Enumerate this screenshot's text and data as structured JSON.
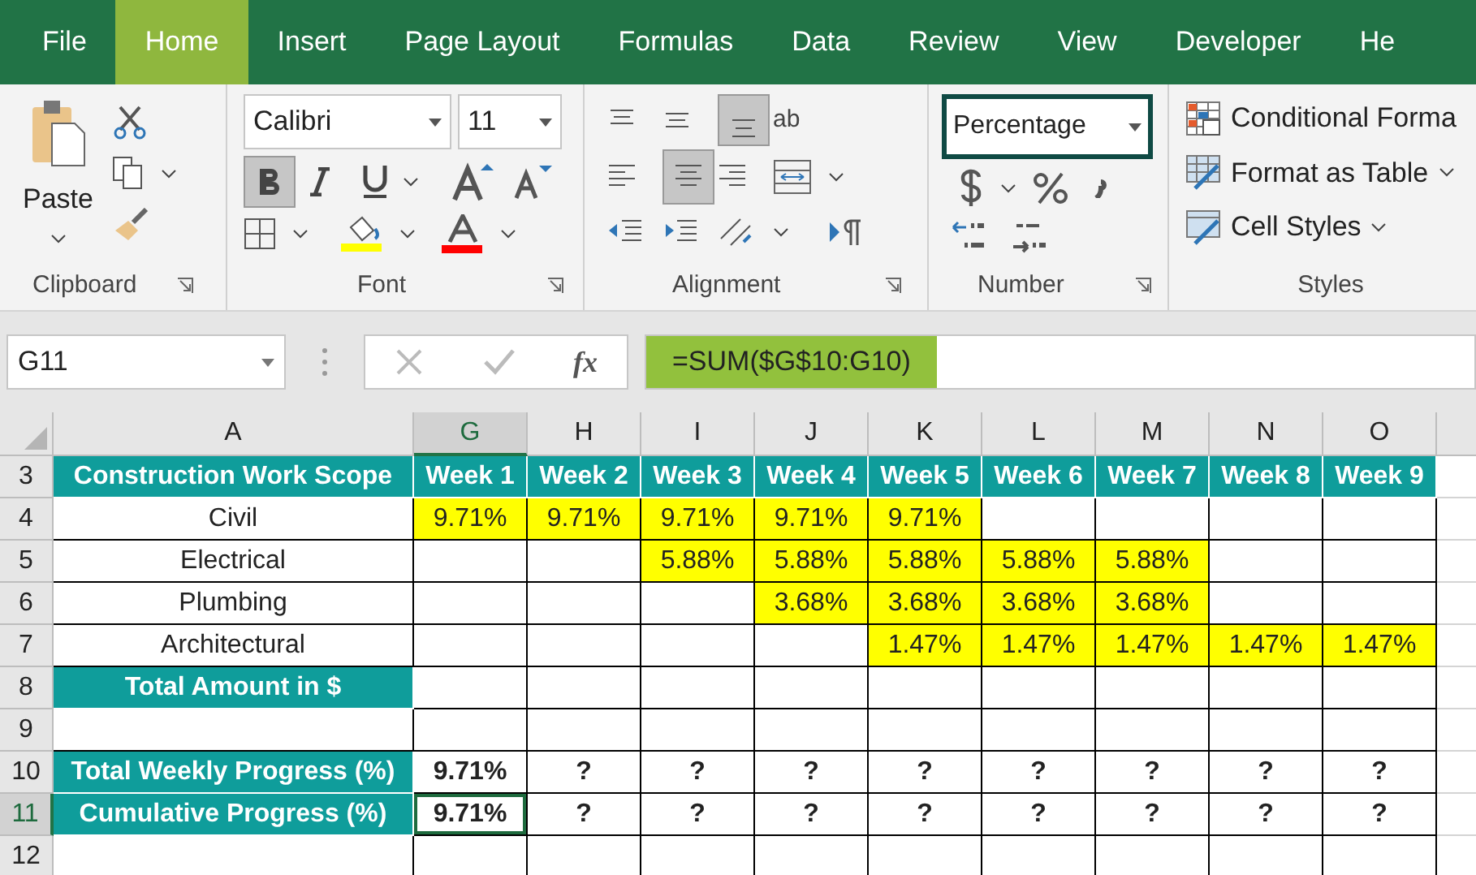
{
  "tabs": [
    {
      "label": "File",
      "selected": false
    },
    {
      "label": "Home",
      "selected": true
    },
    {
      "label": "Insert",
      "selected": false
    },
    {
      "label": "Page Layout",
      "selected": false
    },
    {
      "label": "Formulas",
      "selected": false
    },
    {
      "label": "Data",
      "selected": false
    },
    {
      "label": "Review",
      "selected": false
    },
    {
      "label": "View",
      "selected": false
    },
    {
      "label": "Developer",
      "selected": false
    },
    {
      "label": "He",
      "selected": false
    }
  ],
  "ribbon": {
    "clipboard": {
      "paste": "Paste",
      "label": "Clipboard"
    },
    "font": {
      "name": "Calibri",
      "size": "11",
      "bold_on": true,
      "label": "Font"
    },
    "alignment": {
      "wrap_text": "ab",
      "label": "Alignment"
    },
    "number": {
      "format": "Percentage",
      "label": "Number"
    },
    "styles": {
      "items": [
        "Conditional Forma",
        "Format as Table",
        "Cell Styles"
      ],
      "label": "Styles"
    }
  },
  "formula_bar": {
    "name_box": "G11",
    "function": "fx",
    "formula": "=SUM($G$10:G10)"
  },
  "sheet": {
    "columns": [
      {
        "label": "A",
        "selected": false
      },
      {
        "label": "G",
        "selected": true
      },
      {
        "label": "H",
        "selected": false
      },
      {
        "label": "I",
        "selected": false
      },
      {
        "label": "J",
        "selected": false
      },
      {
        "label": "K",
        "selected": false
      },
      {
        "label": "L",
        "selected": false
      },
      {
        "label": "M",
        "selected": false
      },
      {
        "label": "N",
        "selected": false
      },
      {
        "label": "O",
        "selected": false
      }
    ],
    "rows": [
      {
        "number": "3",
        "selected": false,
        "cells": [
          {
            "text": "Construction Work Scope",
            "kind": "heading",
            "selected": false
          },
          {
            "text": "Week 1",
            "kind": "heading",
            "selected": false
          },
          {
            "text": "Week 2",
            "kind": "heading",
            "selected": false
          },
          {
            "text": "Week 3",
            "kind": "heading",
            "selected": false
          },
          {
            "text": "Week 4",
            "kind": "heading",
            "selected": false
          },
          {
            "text": "Week 5",
            "kind": "heading",
            "selected": false
          },
          {
            "text": "Week 6",
            "kind": "heading",
            "selected": false
          },
          {
            "text": "Week 7",
            "kind": "heading",
            "selected": false
          },
          {
            "text": "Week 8",
            "kind": "heading",
            "selected": false
          },
          {
            "text": "Week 9",
            "kind": "heading",
            "selected": false
          }
        ]
      },
      {
        "number": "4",
        "selected": false,
        "cells": [
          {
            "text": "Civil",
            "kind": "plain",
            "selected": false
          },
          {
            "text": "9.71%",
            "kind": "value",
            "selected": false
          },
          {
            "text": "9.71%",
            "kind": "value",
            "selected": false
          },
          {
            "text": "9.71%",
            "kind": "value",
            "selected": false
          },
          {
            "text": "9.71%",
            "kind": "value",
            "selected": false
          },
          {
            "text": "9.71%",
            "kind": "value",
            "selected": false
          },
          {
            "kind": "plain",
            "selected": false
          },
          {
            "kind": "plain",
            "selected": false
          },
          {
            "kind": "plain",
            "selected": false
          },
          {
            "kind": "plain",
            "selected": false
          }
        ]
      },
      {
        "number": "5",
        "selected": false,
        "cells": [
          {
            "text": "Electrical",
            "kind": "plain",
            "selected": false
          },
          {
            "kind": "plain",
            "selected": false
          },
          {
            "kind": "plain",
            "selected": false
          },
          {
            "text": "5.88%",
            "kind": "value",
            "selected": false
          },
          {
            "text": "5.88%",
            "kind": "value",
            "selected": false
          },
          {
            "text": "5.88%",
            "kind": "value",
            "selected": false
          },
          {
            "text": "5.88%",
            "kind": "value",
            "selected": false
          },
          {
            "text": "5.88%",
            "kind": "value",
            "selected": false
          },
          {
            "kind": "plain",
            "selected": false
          },
          {
            "kind": "plain",
            "selected": false
          }
        ]
      },
      {
        "number": "6",
        "selected": false,
        "cells": [
          {
            "text": "Plumbing",
            "kind": "plain",
            "selected": false
          },
          {
            "kind": "plain",
            "selected": false
          },
          {
            "kind": "plain",
            "selected": false
          },
          {
            "kind": "plain",
            "selected": false
          },
          {
            "text": "3.68%",
            "kind": "value",
            "selected": false
          },
          {
            "text": "3.68%",
            "kind": "value",
            "selected": false
          },
          {
            "text": "3.68%",
            "kind": "value",
            "selected": false
          },
          {
            "text": "3.68%",
            "kind": "value",
            "selected": false
          },
          {
            "kind": "plain",
            "selected": false
          },
          {
            "kind": "plain",
            "selected": false
          }
        ]
      },
      {
        "number": "7",
        "selected": false,
        "cells": [
          {
            "text": "Architectural",
            "kind": "plain",
            "selected": false
          },
          {
            "kind": "plain",
            "selected": false
          },
          {
            "kind": "plain",
            "selected": false
          },
          {
            "kind": "plain",
            "selected": false
          },
          {
            "kind": "plain",
            "selected": false
          },
          {
            "text": "1.47%",
            "kind": "value",
            "selected": false
          },
          {
            "text": "1.47%",
            "kind": "value",
            "selected": false
          },
          {
            "text": "1.47%",
            "kind": "value",
            "selected": false
          },
          {
            "text": "1.47%",
            "kind": "value",
            "selected": false
          },
          {
            "text": "1.47%",
            "kind": "value",
            "selected": false
          }
        ]
      },
      {
        "number": "8",
        "selected": false,
        "cells": [
          {
            "text": "Total Amount in $",
            "kind": "heading",
            "selected": false
          },
          {
            "kind": "plain",
            "selected": false
          },
          {
            "kind": "plain",
            "selected": false
          },
          {
            "kind": "plain",
            "selected": false
          },
          {
            "kind": "plain",
            "selected": false
          },
          {
            "kind": "plain",
            "selected": false
          },
          {
            "kind": "plain",
            "selected": false
          },
          {
            "kind": "plain",
            "selected": false
          },
          {
            "kind": "plain",
            "selected": false
          },
          {
            "kind": "plain",
            "selected": false
          }
        ]
      },
      {
        "number": "9",
        "selected": false,
        "cells": [
          {
            "kind": "plain",
            "selected": false
          },
          {
            "kind": "plain",
            "selected": false
          },
          {
            "kind": "plain",
            "selected": false
          },
          {
            "kind": "plain",
            "selected": false
          },
          {
            "kind": "plain",
            "selected": false
          },
          {
            "kind": "plain",
            "selected": false
          },
          {
            "kind": "plain",
            "selected": false
          },
          {
            "kind": "plain",
            "selected": false
          },
          {
            "kind": "plain",
            "selected": false
          },
          {
            "kind": "plain",
            "selected": false
          }
        ]
      },
      {
        "number": "10",
        "selected": false,
        "cells": [
          {
            "text": "Total Weekly Progress (%)",
            "kind": "heading",
            "selected": false
          },
          {
            "text": "9.71%",
            "kind": "result",
            "selected": false
          },
          {
            "text": "?",
            "kind": "result",
            "selected": false
          },
          {
            "text": "?",
            "kind": "result",
            "selected": false
          },
          {
            "text": "?",
            "kind": "result",
            "selected": false
          },
          {
            "text": "?",
            "kind": "result",
            "selected": false
          },
          {
            "text": "?",
            "kind": "result",
            "selected": false
          },
          {
            "text": "?",
            "kind": "result",
            "selected": false
          },
          {
            "text": "?",
            "kind": "result",
            "selected": false
          },
          {
            "text": "?",
            "kind": "result",
            "selected": false
          }
        ]
      },
      {
        "number": "11",
        "selected": true,
        "cells": [
          {
            "text": "Cumulative Progress (%)",
            "kind": "heading",
            "selected": false
          },
          {
            "text": "9.71%",
            "kind": "result",
            "selected": true
          },
          {
            "text": "?",
            "kind": "result",
            "selected": false
          },
          {
            "text": "?",
            "kind": "result",
            "selected": false
          },
          {
            "text": "?",
            "kind": "result",
            "selected": false
          },
          {
            "text": "?",
            "kind": "result",
            "selected": false
          },
          {
            "text": "?",
            "kind": "result",
            "selected": false
          },
          {
            "text": "?",
            "kind": "result",
            "selected": false
          },
          {
            "text": "?",
            "kind": "result",
            "selected": false
          },
          {
            "text": "?",
            "kind": "result",
            "selected": false
          }
        ]
      },
      {
        "number": "12",
        "selected": false,
        "cells": [
          {
            "kind": "plain",
            "selected": false
          },
          {
            "kind": "plain",
            "selected": false
          },
          {
            "kind": "plain",
            "selected": false
          },
          {
            "kind": "plain",
            "selected": false
          },
          {
            "kind": "plain",
            "selected": false
          },
          {
            "kind": "plain",
            "selected": false
          },
          {
            "kind": "plain",
            "selected": false
          },
          {
            "kind": "plain",
            "selected": false
          },
          {
            "kind": "plain",
            "selected": false
          },
          {
            "kind": "plain",
            "selected": false
          }
        ]
      }
    ]
  }
}
